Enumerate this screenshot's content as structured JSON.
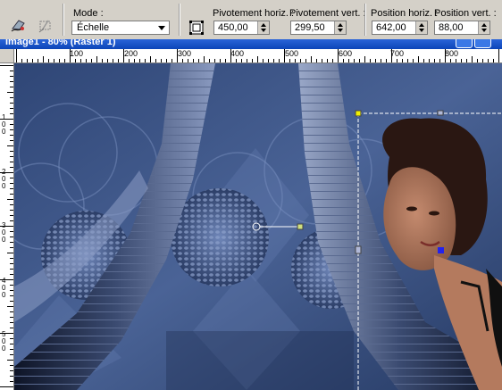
{
  "toolbar": {
    "mode_label": "Mode :",
    "mode_value": "Échelle",
    "pivot_h_label": "Pivotement horiz. :",
    "pivot_h_value": "450,00",
    "pivot_v_label": "Pivotement vert. :",
    "pivot_v_value": "299,50",
    "pos_h_label": "Position horiz. :",
    "pos_h_value": "642,00",
    "pos_v_label": "Position vert. :",
    "pos_v_value": "88,00",
    "icons": [
      "pick-tool-icon",
      "deform-tool-icon",
      "apply-deform-icon"
    ]
  },
  "window": {
    "title": "Image1 - 80% (Raster 1)"
  },
  "ruler": {
    "h_labels": [
      "100",
      "200",
      "300",
      "400",
      "500",
      "600",
      "700",
      "800"
    ],
    "v_labels": [
      "1\n0\n0",
      "2\n0\n0",
      "3\n0\n0",
      "4\n0\n0",
      "5\n0\n0"
    ]
  },
  "colors": {
    "accent": "#0c45b8",
    "canvas_bg": "#3e5686",
    "selection": "#f0f000"
  }
}
